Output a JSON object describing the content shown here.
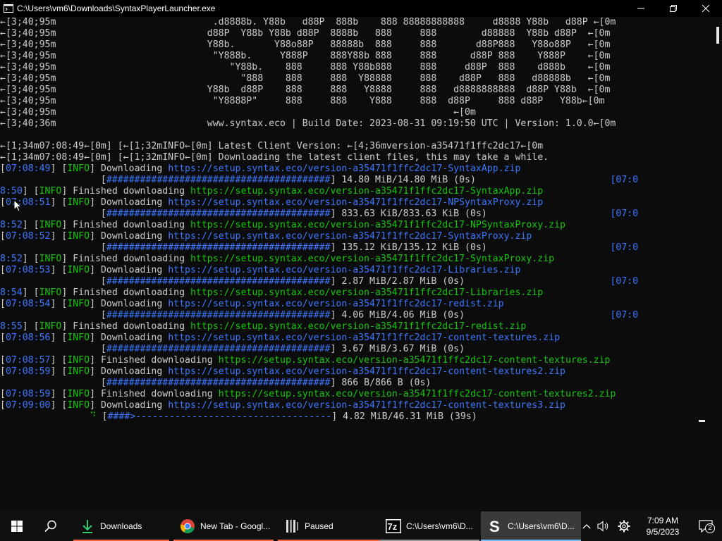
{
  "window": {
    "title": "C:\\Users\\vm6\\Downloads\\SyntaxPlayerLauncher.exe"
  },
  "terminal": {
    "lines": [
      {
        "segs": [
          {
            "t": "←[3;40;95m                            .d8888b. Y88b   d88P  888b    888 88888888888     d8888 Y88b   d88P ←[0m",
            "c": "white"
          }
        ]
      },
      {
        "segs": [
          {
            "t": "←[3;40;95m                           d88P  Y88b Y88b d88P  8888b   888     888        d88888  Y88b d88P  ←[0m",
            "c": "white"
          }
        ]
      },
      {
        "segs": [
          {
            "t": "←[3;40;95m                           Y88b.       Y88o88P   88888b  888     888       d88P888   Y88o88P   ←[0m",
            "c": "white"
          }
        ]
      },
      {
        "segs": [
          {
            "t": "←[3;40;95m                            \"Y888b.     Y888P    888Y88b 888     888      d88P 888    Y888P    ←[0m",
            "c": "white"
          }
        ]
      },
      {
        "segs": [
          {
            "t": "←[3;40;95m                               \"Y88b.    888     888 Y88b888     888     d88P  888    d888b    ←[0m",
            "c": "white"
          }
        ]
      },
      {
        "segs": [
          {
            "t": "←[3;40;95m                                 \"888    888     888  Y88888     888    d88P   888   d88888b   ←[0m",
            "c": "white"
          }
        ]
      },
      {
        "segs": [
          {
            "t": "←[3;40;95m                           Y88b  d88P    888     888   Y8888     888   d8888888888  d88P Y88b  ←[0m",
            "c": "white"
          }
        ]
      },
      {
        "segs": [
          {
            "t": "←[3;40;95m                            \"Y8888P\"     888     888    Y888     888  d88P     888 d88P   Y88b←[0m",
            "c": "white"
          }
        ]
      },
      {
        "segs": [
          {
            "t": "←[3;40;95m                                                                       ←[0m",
            "c": "white"
          }
        ]
      },
      {
        "segs": [
          {
            "t": "←[3;40;36m                           www.syntax.eco | Build Date: 2023-08-31 09:19:50 UTC | Version: 1.0.0←[0m",
            "c": "white"
          }
        ]
      },
      {
        "segs": [
          {
            "t": "",
            "c": "white"
          }
        ]
      },
      {
        "segs": [
          {
            "t": "←[1;34m07:08:49←[0m] [←[1;32mINFO←[0m] Latest Client Version: ←[4;36mversion-a35471f1ffc2dc17←[0m",
            "c": "white"
          }
        ]
      },
      {
        "segs": [
          {
            "t": "←[1;34m07:08:49←[0m] [←[1;32mINFO←[0m] Downloading the latest client files, this may take a while.",
            "c": "white"
          }
        ]
      },
      {
        "segs": [
          {
            "t": "[",
            "c": "white"
          },
          {
            "t": "07:08:49",
            "c": "blue"
          },
          {
            "t": "] [",
            "c": "white"
          },
          {
            "t": "INFO",
            "c": "green"
          },
          {
            "t": "] Downloading ",
            "c": "white"
          },
          {
            "t": "https://setup.syntax.eco/version-a35471f1ffc2dc17-SyntaxApp.zip",
            "c": "blue"
          }
        ]
      },
      {
        "segs": [
          {
            "t": "                  [",
            "c": "white"
          },
          {
            "t": "########################################",
            "c": "blue"
          },
          {
            "t": "] 14.80 MiB/14.80 MiB (0s)                        ",
            "c": "white"
          },
          {
            "t": "[07:0",
            "c": "blue"
          }
        ]
      },
      {
        "segs": [
          {
            "t": "8:50",
            "c": "blue"
          },
          {
            "t": "] [",
            "c": "white"
          },
          {
            "t": "INFO",
            "c": "green"
          },
          {
            "t": "] Finished downloading ",
            "c": "white"
          },
          {
            "t": "https://setup.syntax.eco/version-a35471f1ffc2dc17-SyntaxApp.zip",
            "c": "green"
          }
        ]
      },
      {
        "segs": [
          {
            "t": "[",
            "c": "white"
          },
          {
            "t": "07:08:51",
            "c": "blue"
          },
          {
            "t": "] [",
            "c": "white"
          },
          {
            "t": "INFO",
            "c": "green"
          },
          {
            "t": "] Downloading ",
            "c": "white"
          },
          {
            "t": "https://setup.syntax.eco/version-a35471f1ffc2dc17-NPSyntaxProxy.zip",
            "c": "blue"
          }
        ]
      },
      {
        "segs": [
          {
            "t": "                  [",
            "c": "white"
          },
          {
            "t": "########################################",
            "c": "blue"
          },
          {
            "t": "] 833.63 KiB/833.63 KiB (0s)                      ",
            "c": "white"
          },
          {
            "t": "[07:0",
            "c": "blue"
          }
        ]
      },
      {
        "segs": [
          {
            "t": "8:52",
            "c": "blue"
          },
          {
            "t": "] [",
            "c": "white"
          },
          {
            "t": "INFO",
            "c": "green"
          },
          {
            "t": "] Finished downloading ",
            "c": "white"
          },
          {
            "t": "https://setup.syntax.eco/version-a35471f1ffc2dc17-NPSyntaxProxy.zip",
            "c": "green"
          }
        ]
      },
      {
        "segs": [
          {
            "t": "[",
            "c": "white"
          },
          {
            "t": "07:08:52",
            "c": "blue"
          },
          {
            "t": "] [",
            "c": "white"
          },
          {
            "t": "INFO",
            "c": "green"
          },
          {
            "t": "] Downloading ",
            "c": "white"
          },
          {
            "t": "https://setup.syntax.eco/version-a35471f1ffc2dc17-SyntaxProxy.zip",
            "c": "blue"
          }
        ]
      },
      {
        "segs": [
          {
            "t": "                  [",
            "c": "white"
          },
          {
            "t": "########################################",
            "c": "blue"
          },
          {
            "t": "] 135.12 KiB/135.12 KiB (0s)                      ",
            "c": "white"
          },
          {
            "t": "[07:0",
            "c": "blue"
          }
        ]
      },
      {
        "segs": [
          {
            "t": "8:52",
            "c": "blue"
          },
          {
            "t": "] [",
            "c": "white"
          },
          {
            "t": "INFO",
            "c": "green"
          },
          {
            "t": "] Finished downloading ",
            "c": "white"
          },
          {
            "t": "https://setup.syntax.eco/version-a35471f1ffc2dc17-SyntaxProxy.zip",
            "c": "green"
          }
        ]
      },
      {
        "segs": [
          {
            "t": "[",
            "c": "white"
          },
          {
            "t": "07:08:53",
            "c": "blue"
          },
          {
            "t": "] [",
            "c": "white"
          },
          {
            "t": "INFO",
            "c": "green"
          },
          {
            "t": "] Downloading ",
            "c": "white"
          },
          {
            "t": "https://setup.syntax.eco/version-a35471f1ffc2dc17-Libraries.zip",
            "c": "blue"
          }
        ]
      },
      {
        "segs": [
          {
            "t": "                  [",
            "c": "white"
          },
          {
            "t": "########################################",
            "c": "blue"
          },
          {
            "t": "] 2.87 MiB/2.87 MiB (0s)                          ",
            "c": "white"
          },
          {
            "t": "[07:0",
            "c": "blue"
          }
        ]
      },
      {
        "segs": [
          {
            "t": "8:54",
            "c": "blue"
          },
          {
            "t": "] [",
            "c": "white"
          },
          {
            "t": "INFO",
            "c": "green"
          },
          {
            "t": "] Finished downloading ",
            "c": "white"
          },
          {
            "t": "https://setup.syntax.eco/version-a35471f1ffc2dc17-Libraries.zip",
            "c": "green"
          }
        ]
      },
      {
        "segs": [
          {
            "t": "[",
            "c": "white"
          },
          {
            "t": "07:08:54",
            "c": "blue"
          },
          {
            "t": "] [",
            "c": "white"
          },
          {
            "t": "INFO",
            "c": "green"
          },
          {
            "t": "] Downloading ",
            "c": "white"
          },
          {
            "t": "https://setup.syntax.eco/version-a35471f1ffc2dc17-redist.zip",
            "c": "blue"
          }
        ]
      },
      {
        "segs": [
          {
            "t": "                  [",
            "c": "white"
          },
          {
            "t": "########################################",
            "c": "blue"
          },
          {
            "t": "] 4.06 MiB/4.06 MiB (0s)                          ",
            "c": "white"
          },
          {
            "t": "[07:0",
            "c": "blue"
          }
        ]
      },
      {
        "segs": [
          {
            "t": "8:55",
            "c": "blue"
          },
          {
            "t": "] [",
            "c": "white"
          },
          {
            "t": "INFO",
            "c": "green"
          },
          {
            "t": "] Finished downloading ",
            "c": "white"
          },
          {
            "t": "https://setup.syntax.eco/version-a35471f1ffc2dc17-redist.zip",
            "c": "green"
          }
        ]
      },
      {
        "segs": [
          {
            "t": "[",
            "c": "white"
          },
          {
            "t": "07:08:56",
            "c": "blue"
          },
          {
            "t": "] [",
            "c": "white"
          },
          {
            "t": "INFO",
            "c": "green"
          },
          {
            "t": "] Downloading ",
            "c": "white"
          },
          {
            "t": "https://setup.syntax.eco/version-a35471f1ffc2dc17-content-textures.zip",
            "c": "blue"
          }
        ]
      },
      {
        "segs": [
          {
            "t": "                  [",
            "c": "white"
          },
          {
            "t": "########################################",
            "c": "blue"
          },
          {
            "t": "] 3.67 MiB/3.67 MiB (0s)",
            "c": "white"
          }
        ]
      },
      {
        "segs": [
          {
            "t": "[",
            "c": "white"
          },
          {
            "t": "07:08:57",
            "c": "blue"
          },
          {
            "t": "] [",
            "c": "white"
          },
          {
            "t": "INFO",
            "c": "green"
          },
          {
            "t": "] Finished downloading ",
            "c": "white"
          },
          {
            "t": "https://setup.syntax.eco/version-a35471f1ffc2dc17-content-textures.zip",
            "c": "green"
          }
        ]
      },
      {
        "segs": [
          {
            "t": "[",
            "c": "white"
          },
          {
            "t": "07:08:59",
            "c": "blue"
          },
          {
            "t": "] [",
            "c": "white"
          },
          {
            "t": "INFO",
            "c": "green"
          },
          {
            "t": "] Downloading ",
            "c": "white"
          },
          {
            "t": "https://setup.syntax.eco/version-a35471f1ffc2dc17-content-textures2.zip",
            "c": "blue"
          }
        ]
      },
      {
        "segs": [
          {
            "t": "                  [",
            "c": "white"
          },
          {
            "t": "########################################",
            "c": "blue"
          },
          {
            "t": "] 866 B/866 B (0s)",
            "c": "white"
          }
        ]
      },
      {
        "segs": [
          {
            "t": "[",
            "c": "white"
          },
          {
            "t": "07:08:59",
            "c": "blue"
          },
          {
            "t": "] [",
            "c": "white"
          },
          {
            "t": "INFO",
            "c": "green"
          },
          {
            "t": "] Finished downloading ",
            "c": "white"
          },
          {
            "t": "https://setup.syntax.eco/version-a35471f1ffc2dc17-content-textures2.zip",
            "c": "green"
          }
        ]
      },
      {
        "segs": [
          {
            "t": "[",
            "c": "white"
          },
          {
            "t": "07:09:00",
            "c": "blue"
          },
          {
            "t": "] [",
            "c": "white"
          },
          {
            "t": "INFO",
            "c": "green"
          },
          {
            "t": "] Downloading ",
            "c": "white"
          },
          {
            "t": "https://setup.syntax.eco/version-a35471f1ffc2dc17-content-textures3.zip",
            "c": "blue"
          }
        ]
      },
      {
        "segs": [
          {
            "t": "                ",
            "c": "white"
          },
          {
            "t": "⠙",
            "c": "green"
          },
          {
            "t": " [",
            "c": "white"
          },
          {
            "t": "####>",
            "c": "blue"
          },
          {
            "t": "-----------------------------------",
            "c": "blue"
          },
          {
            "t": "] 4.82 MiB/46.31 MiB (39s)",
            "c": "white"
          }
        ]
      }
    ],
    "current_download": {
      "progress": 0.104
    }
  },
  "taskbar": {
    "apps": [
      {
        "label": "Downloads",
        "icon": "download-arrow-icon",
        "active": false
      },
      {
        "label": "New Tab - Googl...",
        "icon": "chrome-icon",
        "active": false
      },
      {
        "label": "Paused",
        "icon": "ffmpeg-icon",
        "active": false
      },
      {
        "label": "C:\\Users\\vm6\\D...",
        "icon": "7zip-icon",
        "active": false
      },
      {
        "label": "C:\\Users\\vm6\\D...",
        "icon": "syntax-s-icon",
        "active": true
      }
    ],
    "clock": {
      "time": "7:09 AM",
      "date": "9/5/2023"
    },
    "notifications_count": "2"
  },
  "colors": {
    "terminal_bg": "#0c0c0c",
    "text": "#cccccc",
    "blue": "#3b78ff",
    "green": "#16c60c",
    "taskbar_bg": "#101010",
    "active_underline": "#76b9ed",
    "attention_underline": "#f06543"
  }
}
